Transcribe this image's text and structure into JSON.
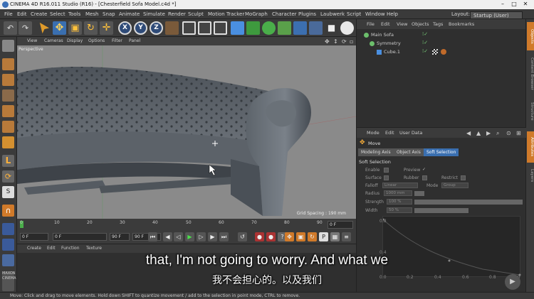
{
  "window": {
    "title": "CINEMA 4D R16.011 Studio (R16) - [Chesterfield Sofa Model.c4d *]",
    "minimize": "–",
    "maximize": "□",
    "close": "✕"
  },
  "menubar": {
    "items": [
      "File",
      "Edit",
      "Create",
      "Select",
      "Tools",
      "Mesh",
      "Snap",
      "Animate",
      "Simulate",
      "Render",
      "Sculpt",
      "Motion Tracker",
      "MoGraph",
      "Character",
      "Plugins",
      "Laubwerk",
      "Script",
      "Window",
      "Help"
    ],
    "layout_label": "Layout:",
    "layout_value": "Startup (User)"
  },
  "toolbar": {
    "x_label": "X",
    "y_label": "Y",
    "z_label": "Z"
  },
  "viewport": {
    "menu": [
      "View",
      "Cameras",
      "Display",
      "Options",
      "Filter",
      "Panel"
    ],
    "label": "Perspective",
    "grid_spacing": "Grid Spacing : 190 mm"
  },
  "timeline": {
    "ticks": [
      "0",
      "10",
      "20",
      "30",
      "40",
      "50",
      "60",
      "70",
      "80",
      "90"
    ],
    "frame_right": "0 F",
    "start_frame": "0 F",
    "current_frame": "0 F",
    "end_frame": "90 F",
    "end_frame2": "90 F"
  },
  "material": {
    "menu": [
      "Create",
      "Edit",
      "Function",
      "Texture"
    ]
  },
  "object_manager": {
    "menu": [
      "File",
      "Edit",
      "View",
      "Objects",
      "Tags",
      "Bookmarks"
    ],
    "objects": [
      "Main Sofa",
      "Symmetry",
      "Cube.1"
    ]
  },
  "side_tabs": [
    "Objects",
    "Content Browser",
    "Structure",
    "Attributes",
    "Layers"
  ],
  "attributes": {
    "menu": [
      "Mode",
      "Edit",
      "User Data"
    ],
    "tool_name": "Move",
    "tabs": [
      "Modeling Axis",
      "Object Axis",
      "Soft Selection"
    ],
    "section_title": "Soft Selection",
    "enable_label": "Enable",
    "preview_label": "Preview",
    "surface_label": "Surface",
    "rubber_label": "Rubber",
    "restrict_label": "Restrict",
    "falloff_label": "Falloff",
    "falloff_value": "Linear",
    "mode_label": "Mode",
    "mode_value": "Group",
    "radius_label": "Radius",
    "radius_value": "1000 mm",
    "strength_label": "Strength",
    "strength_value": "100 %",
    "width_label": "Width",
    "width_value": "50 %",
    "graph_y_ticks": [
      "0.8",
      "0.4"
    ],
    "graph_x_ticks": [
      "0.0",
      "0.2",
      "0.4",
      "0.6",
      "0.8",
      "1.0"
    ]
  },
  "status": "Move: Click and drag to move elements. Hold down SHIFT to quantize movement / add to the selection in point mode, CTRL to remove.",
  "subtitles": {
    "en": "that, I'm not going to worry. And what we",
    "zh": "我不会担心的。以及我们"
  },
  "colors": {
    "accent_blue": "#3a6fb0",
    "viewport_bg": "#8a8a8a",
    "panel_bg": "#2f2f2f",
    "menu_bg": "#3b3b3b"
  }
}
